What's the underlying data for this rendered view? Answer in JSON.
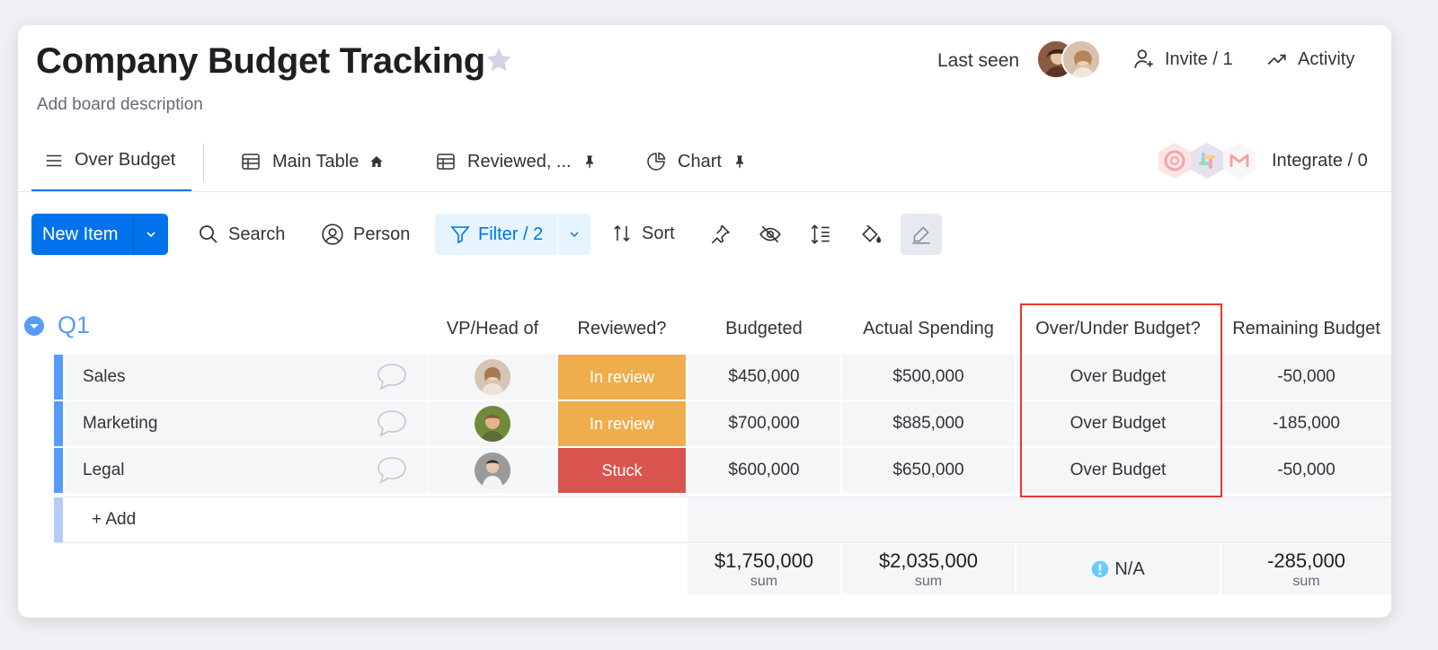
{
  "board": {
    "title": "Company Budget Tracking",
    "description": "Add board description",
    "last_seen_label": "Last seen",
    "invite_label": "Invite / 1",
    "activity_label": "Activity"
  },
  "views": [
    {
      "label": "Over Budget",
      "icon": "menu-icon",
      "active": true
    },
    {
      "label": "Main Table",
      "icon": "table-icon",
      "badge": "home-icon"
    },
    {
      "label": "Reviewed, ...",
      "icon": "table-icon",
      "badge": "pin-icon"
    },
    {
      "label": "Chart",
      "icon": "pie-chart-icon",
      "badge": "pin-icon"
    }
  ],
  "integrate_label": "Integrate / 0",
  "toolbar": {
    "new_item": "New Item",
    "search": "Search",
    "person": "Person",
    "filter": "Filter / 2",
    "sort": "Sort"
  },
  "group": {
    "name": "Q1",
    "color": "#579bfc",
    "columns": [
      "VP/Head of",
      "Reviewed?",
      "Budgeted",
      "Actual Spending",
      "Over/Under Budget?",
      "Remaining Budget"
    ],
    "rows": [
      {
        "name": "Sales",
        "status": "In review",
        "status_color": "#f0ad4e",
        "budgeted": "$450,000",
        "actual": "$500,000",
        "over_under": "Over Budget",
        "remaining": "-50,000"
      },
      {
        "name": "Marketing",
        "status": "In review",
        "status_color": "#f0ad4e",
        "budgeted": "$700,000",
        "actual": "$885,000",
        "over_under": "Over Budget",
        "remaining": "-185,000"
      },
      {
        "name": "Legal",
        "status": "Stuck",
        "status_color": "#d9534f",
        "budgeted": "$600,000",
        "actual": "$650,000",
        "over_under": "Over Budget",
        "remaining": "-50,000"
      }
    ],
    "add_label": "+ Add",
    "summary": {
      "budgeted": "$1,750,000",
      "actual": "$2,035,000",
      "over_under": "N/A",
      "remaining": "-285,000",
      "sum_label": "sum"
    }
  },
  "colors": {
    "accent": "#0073ea",
    "group": "#579bfc",
    "highlight": "#e8372f",
    "in_review": "#f0ad4e",
    "stuck": "#d9534f"
  }
}
